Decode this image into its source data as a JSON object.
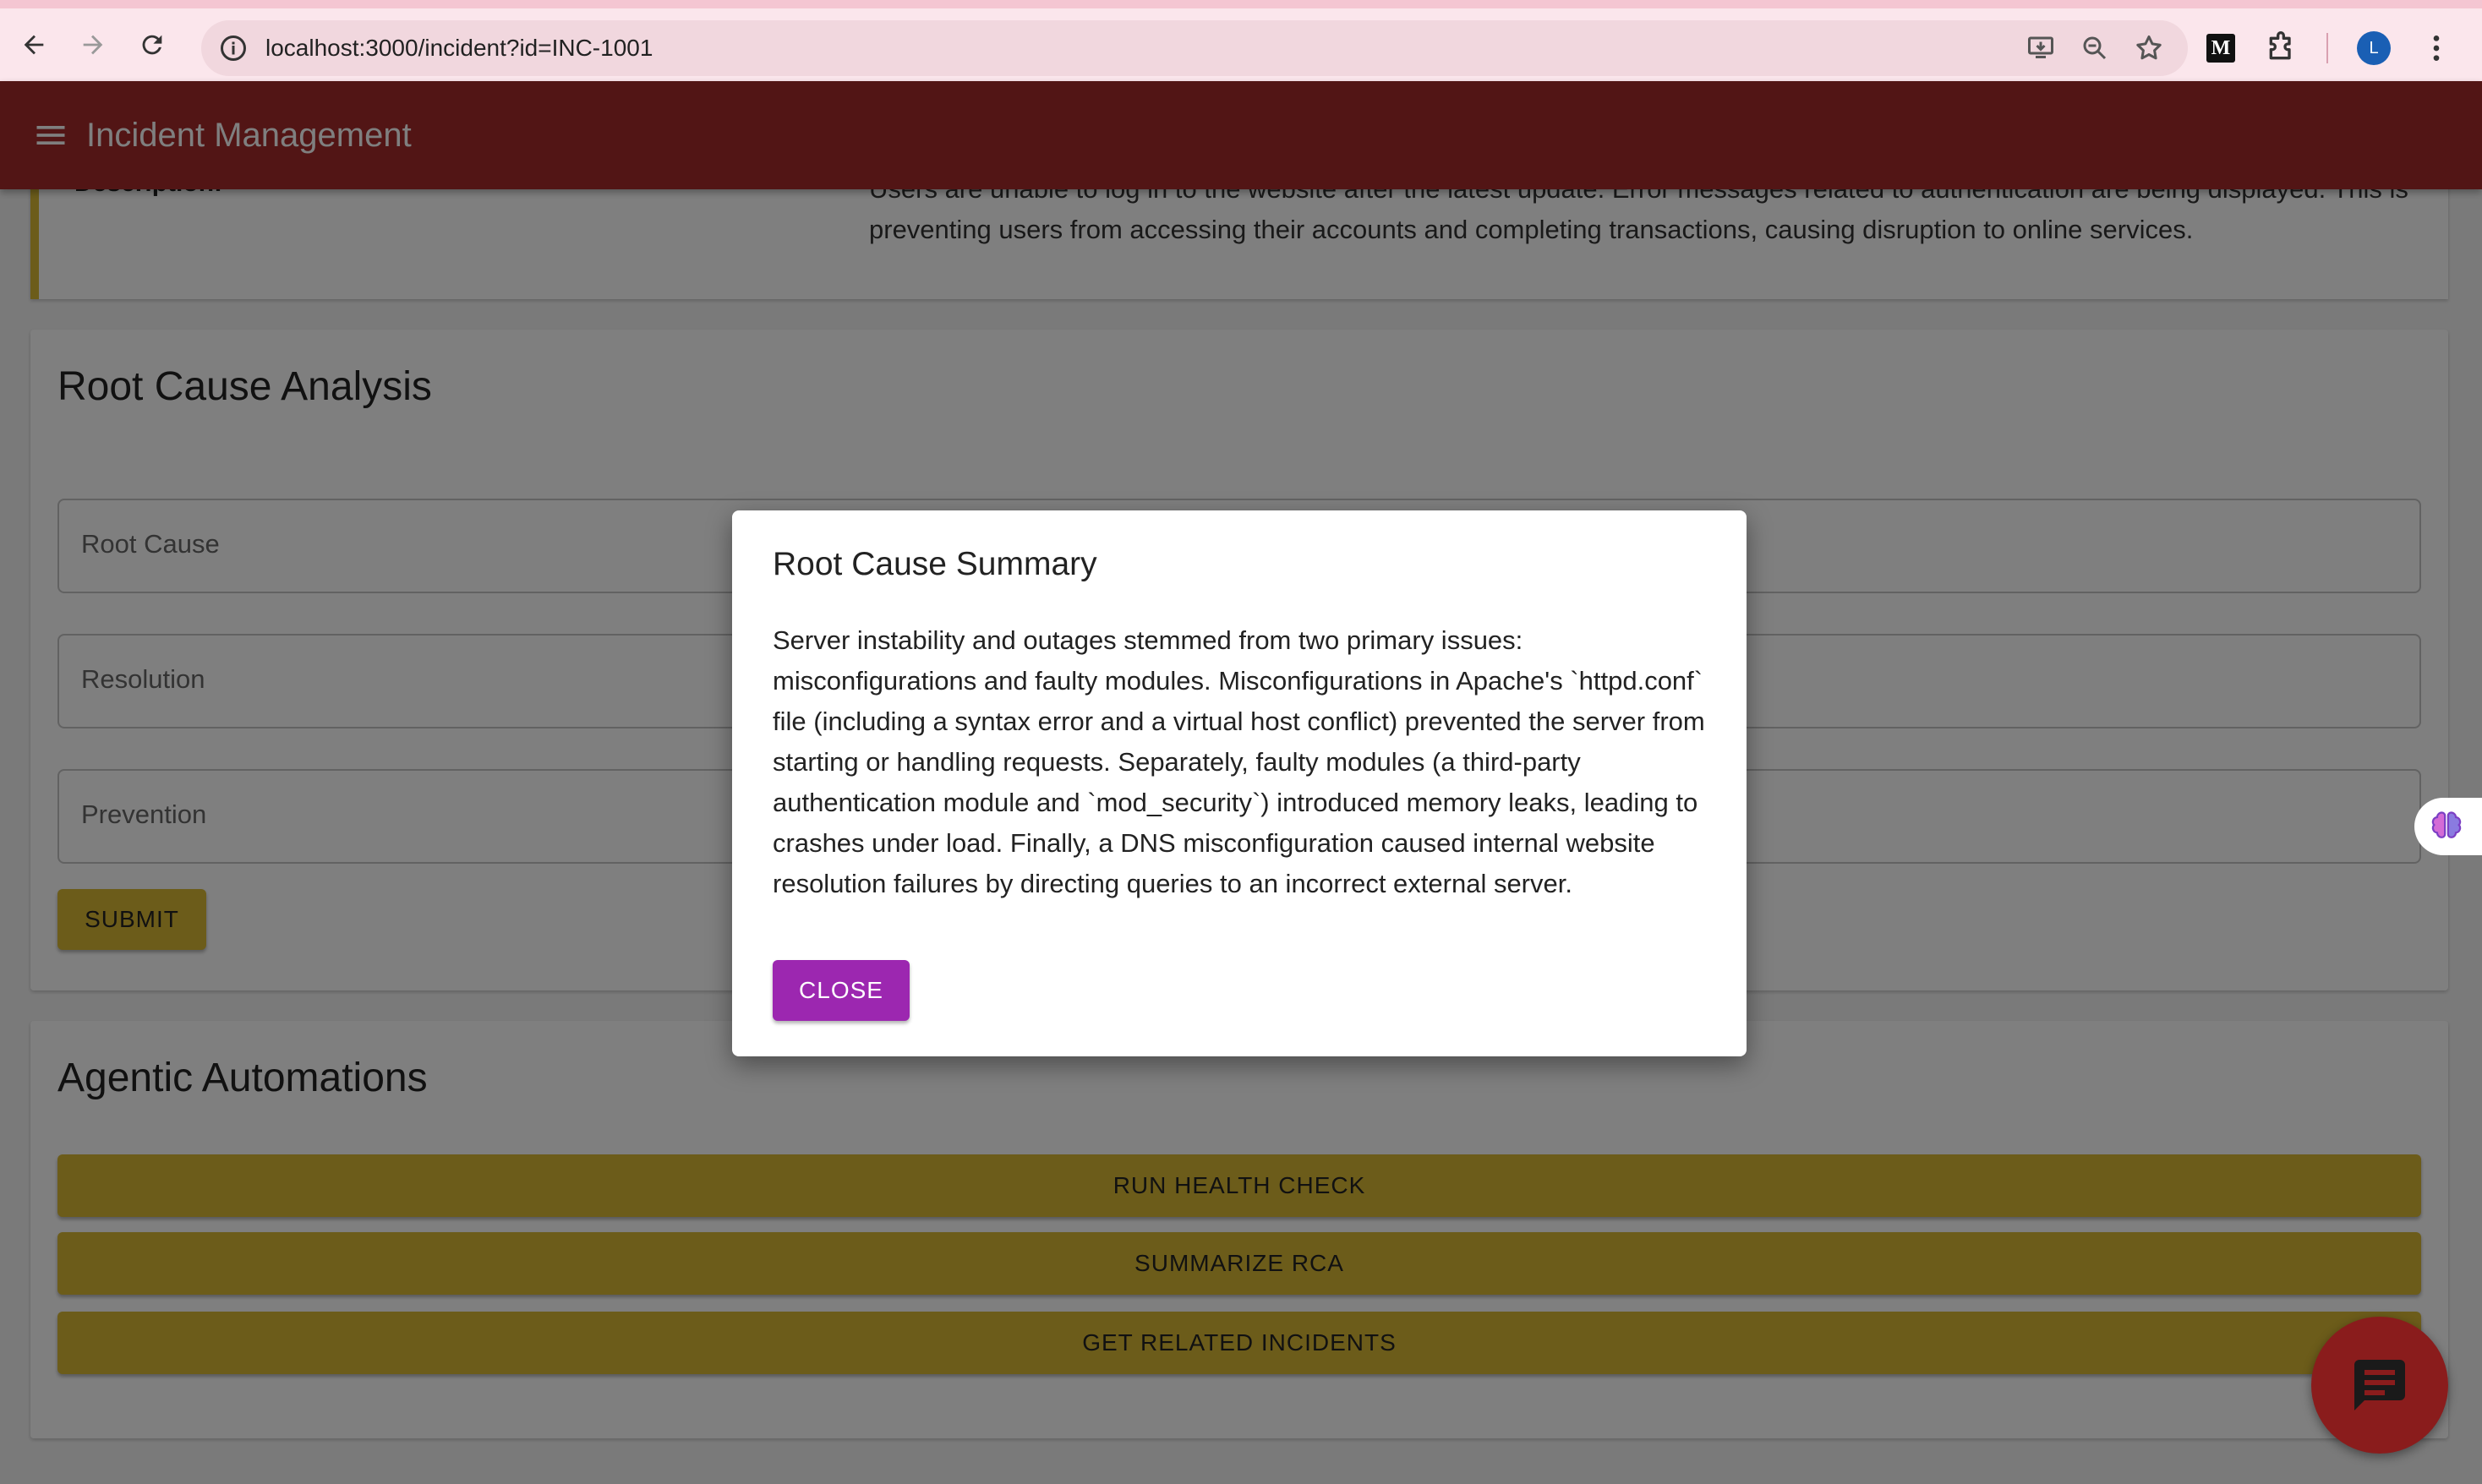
{
  "browser": {
    "url": "localhost:3000/incident?id=INC-1001",
    "extension_m_label": "M",
    "avatar_initial": "L"
  },
  "appbar": {
    "title": "Incident Management"
  },
  "description": {
    "label": "Description:",
    "text": "Users are unable to log in to the website after the latest update. Error messages related to authentication are being displayed. This is preventing users from accessing their accounts and completing transactions, causing disruption to online services."
  },
  "rca": {
    "heading": "Root Cause Analysis",
    "fields": [
      {
        "label": "Root Cause"
      },
      {
        "label": "Resolution"
      },
      {
        "label": "Prevention"
      }
    ],
    "submit_label": "SUBMIT"
  },
  "automations": {
    "heading": "Agentic Automations",
    "buttons": [
      {
        "label": "RUN HEALTH CHECK"
      },
      {
        "label": "SUMMARIZE RCA"
      },
      {
        "label": "GET RELATED INCIDENTS"
      }
    ]
  },
  "dialog": {
    "title": "Root Cause Summary",
    "body": "Server instability and outages stemmed from two primary issues: misconfigurations and faulty modules. Misconfigurations in Apache's `httpd.conf` file (including a syntax error and a virtual host conflict) prevented the server from starting or handling requests. Separately, faulty modules (a third-party authentication module and `mod_security`) introduced memory leaks, leading to crashes under load. Finally, a DNS misconfiguration caused internal website resolution failures by directing queries to an incorrect external server.",
    "close_label": "CLOSE"
  },
  "colors": {
    "appbar": "#a52a2a",
    "accent_yellow": "#d8b835",
    "dialog_button": "#9c27b0",
    "fab": "#8a1c1c"
  }
}
